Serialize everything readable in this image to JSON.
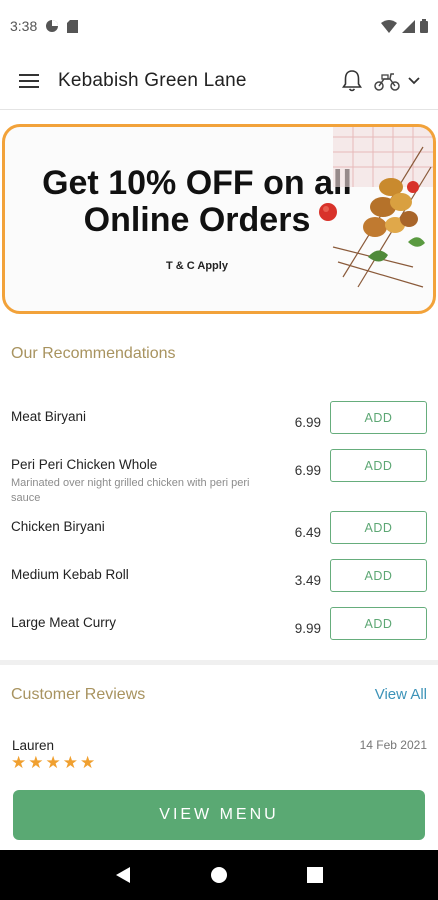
{
  "status_bar": {
    "time": "3:38"
  },
  "header": {
    "title": "Kebabish Green Lane"
  },
  "icons": {
    "menu": "hamburger-menu-icon",
    "notifications": "bell-icon",
    "delivery": "scooter-icon",
    "dropdown": "chevron-down-icon"
  },
  "banner": {
    "headline_line1": "Get 10% OFF on all",
    "headline_line2": "Online Orders",
    "note": "T & C Apply",
    "border_color": "#f2a23a"
  },
  "recommendations": {
    "title": "Our Recommendations",
    "add_label": "ADD",
    "items": [
      {
        "name": "Meat Biryani",
        "description": "",
        "price": "6.99"
      },
      {
        "name": "Peri Peri Chicken Whole",
        "description": "Marinated over night grilled chicken with peri peri sauce",
        "price": "6.99"
      },
      {
        "name": "Chicken Biryani",
        "description": "",
        "price": "6.49"
      },
      {
        "name": "Medium Kebab Roll",
        "description": "",
        "price": "3.49"
      },
      {
        "name": "Large Meat Curry",
        "description": "",
        "price": "9.99"
      }
    ]
  },
  "reviews": {
    "title": "Customer Reviews",
    "view_all": "View All",
    "items": [
      {
        "name": "Lauren",
        "date": "14 Feb 2021",
        "rating": 5
      }
    ]
  },
  "cta": {
    "label": "VIEW MENU"
  },
  "colors": {
    "accent_green": "#5aa973",
    "section_title": "#a8935f",
    "link_blue": "#3d93b8",
    "star": "#f0a030"
  }
}
